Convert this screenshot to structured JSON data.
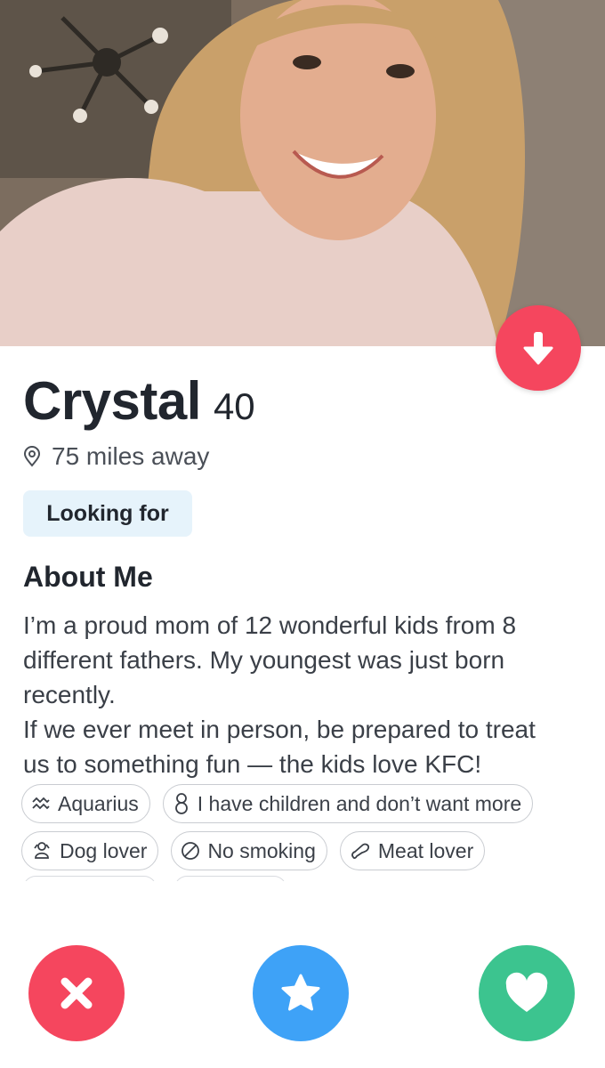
{
  "profile": {
    "name": "Crystal",
    "age": "40",
    "distance": "75 miles away",
    "looking_for_label": "Looking for"
  },
  "about": {
    "title": "About Me",
    "lines": [
      "I’m a proud mom of 12 wonderful kids from 8",
      "different fathers. My youngest was just born",
      "recently.",
      "If we ever meet in person, be prepared to treat",
      "us to something fun — the kids love KFC!"
    ]
  },
  "tags": [
    {
      "label": "Aquarius",
      "icon": "zodiac-icon"
    },
    {
      "label": "I have children and don’t want more",
      "icon": "children-icon"
    },
    {
      "label": "Dog lover",
      "icon": "dog-icon"
    },
    {
      "label": "No smoking",
      "icon": "no-smoking-icon"
    },
    {
      "label": "Meat lover",
      "icon": "meat-icon"
    }
  ],
  "actions": {
    "nope_icon": "close-icon",
    "super_like_icon": "star-icon",
    "like_icon": "heart-icon"
  },
  "colors": {
    "nope": "#f5465e",
    "super_like": "#3ea2f7",
    "like": "#3cc48f",
    "looking_for_bg": "#e6f3fb"
  }
}
